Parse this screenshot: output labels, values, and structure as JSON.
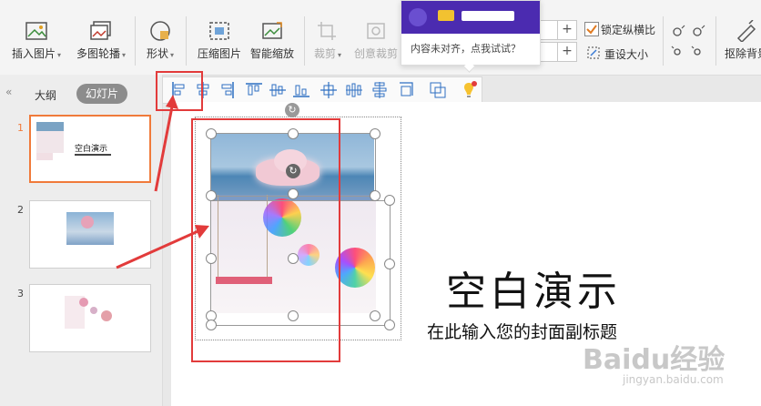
{
  "ribbon": {
    "insert_picture": "插入图片",
    "multi_carousel": "多图轮播",
    "shape": "形状",
    "compress_picture": "压缩图片",
    "smart_zoom": "智能缩放",
    "crop": "裁剪",
    "creative_crop": "创意裁剪",
    "lock_aspect": "锁定纵横比",
    "reset_size": "重设大小",
    "remove_background": "抠除背景"
  },
  "popup": {
    "hint": "内容未对齐，点我试试？"
  },
  "left_panel": {
    "tab_outline": "大纲",
    "tab_slides": "幻灯片",
    "slides": [
      {
        "number": "1",
        "title": "空白演示"
      },
      {
        "number": "2"
      },
      {
        "number": "3"
      }
    ]
  },
  "slide": {
    "title": "空白演示",
    "subtitle": "在此输入您的封面副标题"
  },
  "watermark": {
    "brand": "Baidu经验",
    "url": "jingyan.baidu.com"
  },
  "colors": {
    "accent": "#e23b3b",
    "active_thumb": "#f07a3a",
    "popup_purple": "#4b2bb0"
  }
}
